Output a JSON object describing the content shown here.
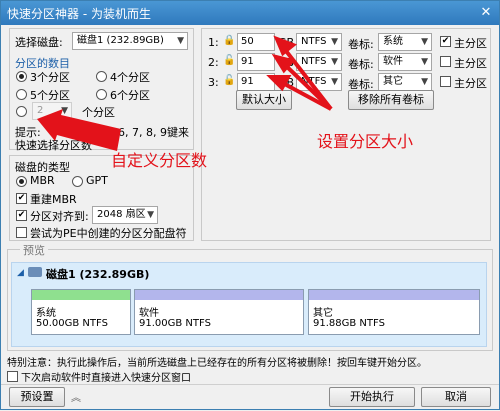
{
  "window": {
    "title": "快速分区神器 - 为装机而生",
    "close": "✕"
  },
  "left": {
    "disk_label": "选择磁盘:",
    "disk_value": "磁盘1 (232.89GB)",
    "count_label": "分区的数目",
    "options": [
      "3个分区",
      "4个分区",
      "5个分区",
      "6个分区"
    ],
    "custom_value": "2",
    "custom_suffix": "个分区",
    "hint_line1": "提示:",
    "hint_numbers": "2, 3, 4, 5, 6, 7, 8, 9键来",
    "hint_line2": "快速选择分区数"
  },
  "disk_type": {
    "group_label": "磁盘的类型",
    "mbr": "MBR",
    "gpt": "GPT",
    "rebuild_mbr": "重建MBR",
    "align_label": "分区对齐到:",
    "align_value": "2048 扇区",
    "pe_option": "尝试为PE中创建的分区分配盘符"
  },
  "rows": [
    {
      "index": "1:",
      "size": "50",
      "unit": "GB",
      "fs": "NTFS",
      "vol_label": "卷标:",
      "vol": "系统",
      "primary": "主分区",
      "primary_checked": true
    },
    {
      "index": "2:",
      "size": "91",
      "unit": "GB",
      "fs": "NTFS",
      "vol_label": "卷标:",
      "vol": "软件",
      "primary": "主分区",
      "primary_checked": false
    },
    {
      "index": "3:",
      "size": "91",
      "unit": "GB",
      "fs": "NTFS",
      "vol_label": "卷标:",
      "vol": "其它",
      "primary": "主分区",
      "primary_checked": false
    }
  ],
  "buttons": {
    "default_size": "默认大小",
    "remove_labels": "移除所有卷标",
    "presets": "预设置",
    "start": "开始执行",
    "cancel": "取消"
  },
  "annotations": {
    "set_size": "设置分区大小",
    "custom_count": "自定义分区数"
  },
  "preview": {
    "label": "预览",
    "disk_name": "磁盘1 (232.89GB)",
    "partitions": [
      {
        "name": "系统",
        "detail": "50.00GB NTFS",
        "color": "#8fe08f"
      },
      {
        "name": "软件",
        "detail": "91.00GB NTFS",
        "color": "#b3b6ec"
      },
      {
        "name": "其它",
        "detail": "91.88GB NTFS",
        "color": "#b3b6ec"
      }
    ]
  },
  "footer": {
    "warning": "特别注意：执行此操作后，当前所选磁盘上已经存在的所有分区将被删除！按回车键开始分区。",
    "next_boot": "下次启动软件时直接进入快速分区窗口"
  },
  "colors": {
    "annotation": "#e3121a",
    "titlebar": "#2f79bd"
  }
}
